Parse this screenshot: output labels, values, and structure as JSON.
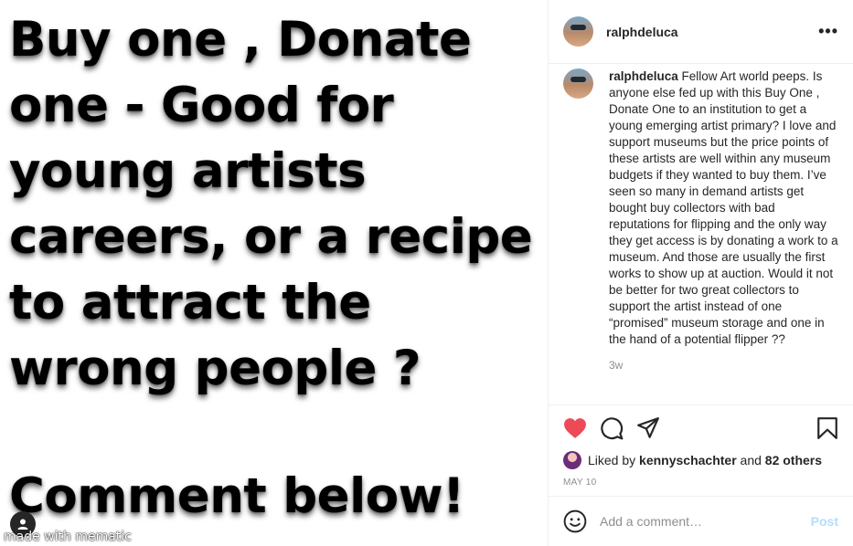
{
  "image": {
    "meme_lines": "Buy one , Donate one - Good for young artists careers, or a recipe to attract the wrong people ?",
    "meme_footer": "Comment below!",
    "watermark": "made with mematic"
  },
  "header": {
    "username": "ralphdeluca",
    "more": "•••"
  },
  "caption": {
    "username": "ralphdeluca",
    "text": "Fellow Art world peeps. Is anyone else fed up with this Buy One , Donate One to an institution to get a young emerging artist primary? I love and support museums but the price points of these artists are well within any museum budgets if they wanted to buy them. I’ve seen so many in demand artists get bought buy collectors with bad reputations for flipping and the only way they get access is by donating a work to a museum. And those are usually the first works to show up at auction. Would it not be better for two great collectors to support the artist instead of one “promised” museum storage and one in the hand of a potential flipper ??",
    "time": "3w"
  },
  "likes": {
    "prefix": "Liked by",
    "user": "kennyschachter",
    "and": "and",
    "others": "82 others"
  },
  "date": "MAY 10",
  "comment_box": {
    "placeholder": "Add a comment…",
    "post_label": "Post"
  },
  "colors": {
    "like_active": "#ed4956",
    "post_disabled": "#b2dffc",
    "secondary_text": "#8e8e8e"
  },
  "icons": [
    "heart-icon",
    "comment-icon",
    "share-icon",
    "bookmark-icon",
    "smiley-icon",
    "user-tag-icon",
    "more-icon"
  ]
}
